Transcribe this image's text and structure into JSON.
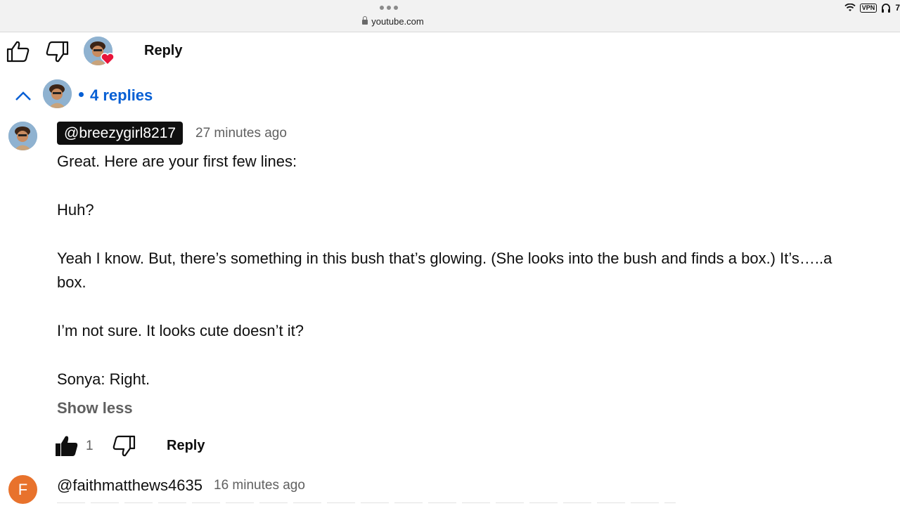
{
  "browser": {
    "url": "youtube.com",
    "status": {
      "vpn_label": "VPN",
      "battery_text": "7"
    }
  },
  "parent_comment": {
    "reply_label": "Reply",
    "replies_label": "4 replies"
  },
  "reply": {
    "author": "@breezygirl8217",
    "time": "27 minutes ago",
    "lines": [
      "Great. Here are your first few lines:",
      "Huh?",
      "Yeah I know. But, there’s something in this bush that’s glowing. (She looks into the bush and finds a box.) It’s…..a",
      "box.",
      "I’m not sure. It looks cute doesn’t it?",
      "Sonya: Right."
    ],
    "show_less_label": "Show less",
    "like_count": "1",
    "reply_label": "Reply"
  },
  "next_reply": {
    "avatar_letter": "F",
    "author": "@faithmatthews4635",
    "time": "16 minutes ago"
  },
  "colors": {
    "link_blue": "#065fd4",
    "heart_red": "#e8143a",
    "avatar_orange": "#e8722c",
    "handle_chip": "#0f0f0f"
  }
}
